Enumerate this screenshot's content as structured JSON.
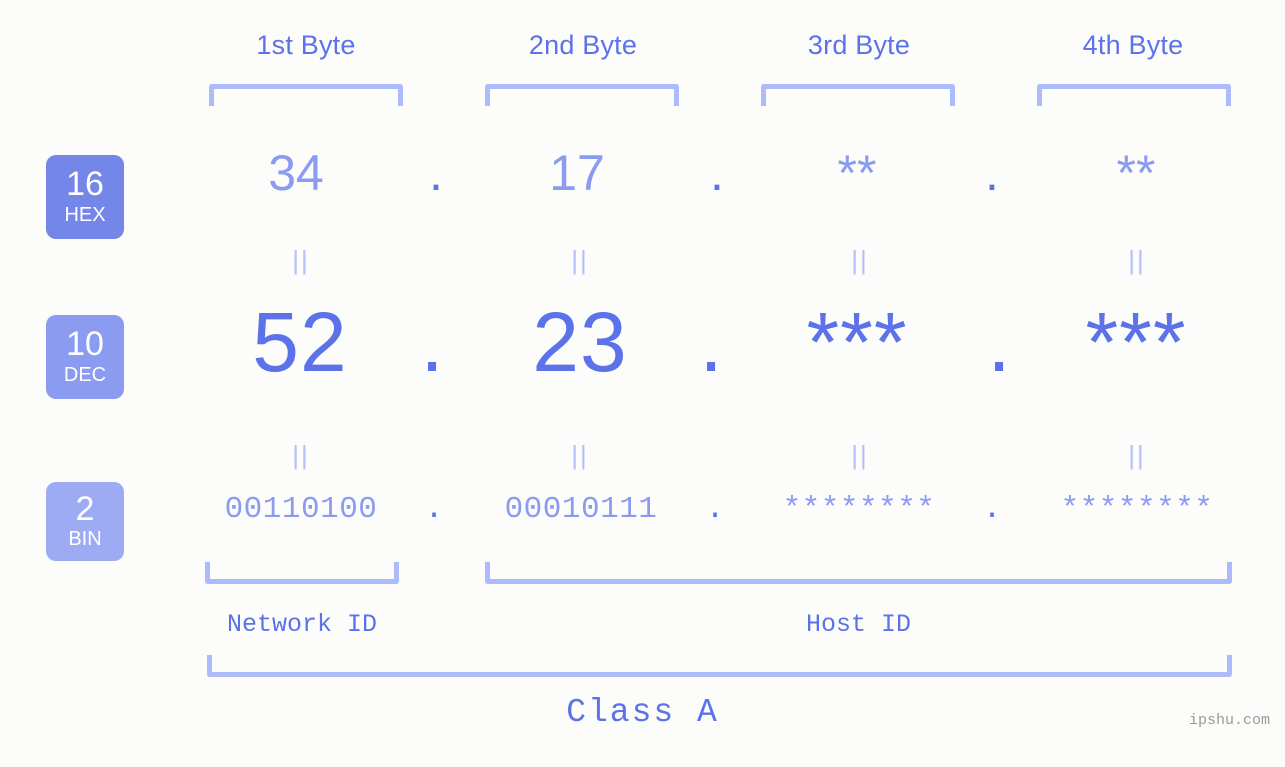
{
  "background_color": "#fcfdfa",
  "colors": {
    "accent_strong": "#5b72e8",
    "accent_mid": "#8b9bf0",
    "accent_light": "#aebbfb",
    "badge_hex": "#7486e8",
    "badge_dec": "#8b9bf0",
    "badge_bin": "#9cabf4",
    "watermark": "#9a9a9a"
  },
  "byte_headers": [
    {
      "label": "1st Byte"
    },
    {
      "label": "2nd Byte"
    },
    {
      "label": "3rd Byte"
    },
    {
      "label": "4th Byte"
    }
  ],
  "bases": [
    {
      "number": "16",
      "name": "HEX"
    },
    {
      "number": "10",
      "name": "DEC"
    },
    {
      "number": "2",
      "name": "BIN"
    }
  ],
  "rows": {
    "hex": {
      "base_number": "16",
      "base_name": "HEX",
      "values": [
        "34",
        "17",
        "**",
        "**"
      ],
      "separator": "."
    },
    "dec": {
      "base_number": "10",
      "base_name": "DEC",
      "values": [
        "52",
        "23",
        "***",
        "***"
      ],
      "separator": "."
    },
    "bin": {
      "base_number": "2",
      "base_name": "BIN",
      "values": [
        "00110100",
        "00010111",
        "********",
        "********"
      ],
      "separator": "."
    }
  },
  "equals_glyph": "||",
  "segments": {
    "network_id": "Network ID",
    "host_id": "Host ID"
  },
  "class_label": "Class A",
  "watermark": "ipshu.com"
}
